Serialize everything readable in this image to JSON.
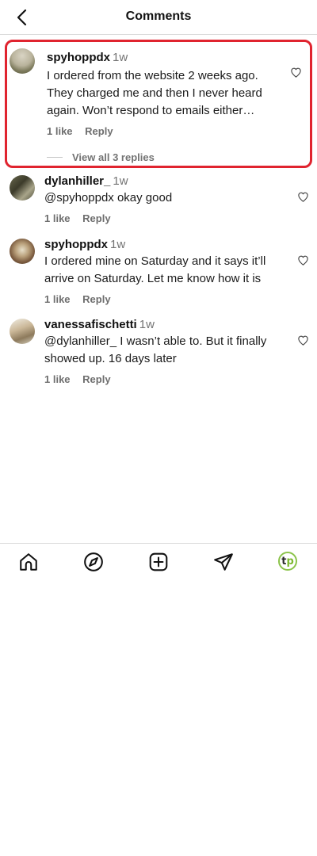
{
  "header": {
    "title": "Comments",
    "back_icon": "chevron-left-icon"
  },
  "comments": [
    {
      "username": "spyhoppdx",
      "time": "1w",
      "text": "I ordered from the website 2 weeks ago. They charged me and then I never heard again. Won’t respond to emails either…",
      "likes": "1 like",
      "reply": "Reply",
      "view_replies": "View all 3 replies",
      "highlighted": true
    },
    {
      "username": "dylanhiller_",
      "time": "1w",
      "text": "@spyhoppdx okay good",
      "likes": "1 like",
      "reply": "Reply"
    },
    {
      "username": "spyhoppdx",
      "time": "1w",
      "text": "I ordered mine on Saturday and it says it’ll arrive on Saturday. Let me know how it is",
      "likes": "1 like",
      "reply": "Reply"
    },
    {
      "username": "vanessafischetti",
      "time": "1w",
      "text": "@dylanhiller_ I wasn’t able to. But it finally showed up. 16 days later",
      "likes": "1 like",
      "reply": "Reply"
    }
  ],
  "nav": {
    "items": [
      "home-icon",
      "explore-icon",
      "create-icon",
      "direct-icon",
      "profile-avatar"
    ],
    "profile_initials": {
      "t": "t",
      "p": "p"
    }
  },
  "colors": {
    "highlight_border": "#e0242f",
    "profile_ring": "#8bc34a"
  }
}
